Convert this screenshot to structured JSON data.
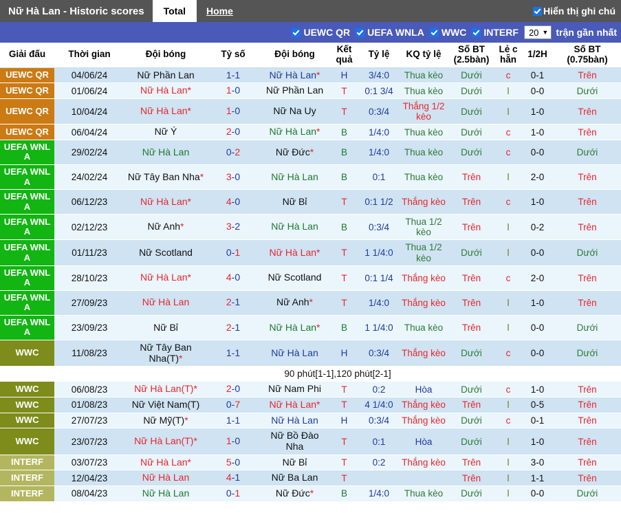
{
  "topbar": {
    "title": "Nữ Hà Lan - Historic scores",
    "tab_total": "Total",
    "link_home": "Home",
    "note_toggle_label": "Hiển thị ghi chú",
    "note_toggle_checked": true,
    "bg_color": "#555555"
  },
  "filterbar": {
    "bg_color": "#4a5ab9",
    "filters": [
      {
        "label": "UEWC QR",
        "checked": true
      },
      {
        "label": "UEFA WNLA",
        "checked": true
      },
      {
        "label": "WWC",
        "checked": true
      },
      {
        "label": "INTERF",
        "checked": true
      }
    ],
    "count_select": {
      "value": "20",
      "caret": "❯"
    },
    "tail_label": "trận gần nhất"
  },
  "table": {
    "headers": [
      "Giải đấu",
      "Thời gian",
      "Đội bóng",
      "Tỷ số",
      "Đội bóng",
      "Kết quả",
      "Tỷ lệ",
      "KQ tỷ lệ",
      "Số BT (2.5bàn)",
      "Lẻ c hẵn",
      "1/2H",
      "Số BT (0.75bàn)"
    ],
    "league_colors": {
      "UEWC QR": "#cc7a14",
      "UEFA WNLA": "#12b512",
      "WWC": "#7d8c1b",
      "INTERF": "#b3b65e"
    },
    "rows": [
      {
        "league": "UEWC QR",
        "league_key": "UEWC QR",
        "date": "04/06/24",
        "home": "Nữ Phần Lan",
        "home_color": "c-black",
        "home_star": false,
        "score_h": "1",
        "score_a": "1",
        "score_h_color": "sc-l",
        "score_a_color": "sc-l",
        "away": "Nữ Hà Lan",
        "away_color": "c-blue",
        "away_star": true,
        "result": "H",
        "result_color": "c-blue",
        "odds": "3/4:0",
        "odds_color": "c-blue",
        "odds_result": "Thua kèo",
        "odds_result_color": "c-dgreen",
        "ou25": "Dưới",
        "ou25_color": "c-dgreen",
        "oddeven": "c",
        "oddeven_color": "c-red",
        "half": "0-1",
        "half_color": "c-black",
        "ou075": "Trên",
        "ou075_color": "c-red"
      },
      {
        "league": "UEWC QR",
        "league_key": "UEWC QR",
        "date": "01/06/24",
        "home": "Nữ Hà Lan",
        "home_color": "c-red",
        "home_star": true,
        "score_h": "1",
        "score_a": "0",
        "score_h_color": "sc-w",
        "score_a_color": "sc-l",
        "away": "Nữ Phần Lan",
        "away_color": "c-black",
        "away_star": false,
        "result": "T",
        "result_color": "c-red",
        "odds": "0:1 3/4",
        "odds_color": "c-blue",
        "odds_result": "Thua kèo",
        "odds_result_color": "c-dgreen",
        "ou25": "Dưới",
        "ou25_color": "c-dgreen",
        "oddeven": "l",
        "oddeven_color": "c-olive",
        "half": "0-0",
        "half_color": "c-black",
        "ou075": "Dưới",
        "ou075_color": "c-dgreen"
      },
      {
        "league": "UEWC QR",
        "league_key": "UEWC QR",
        "date": "10/04/24",
        "home": "Nữ Hà Lan",
        "home_color": "c-red",
        "home_star": true,
        "score_h": "1",
        "score_a": "0",
        "score_h_color": "sc-w",
        "score_a_color": "sc-l",
        "away": "Nữ Na Uy",
        "away_color": "c-black",
        "away_star": false,
        "result": "T",
        "result_color": "c-red",
        "odds": "0:3/4",
        "odds_color": "c-blue",
        "odds_result": "Thắng 1/2 kèo",
        "odds_result_color": "c-red",
        "ou25": "Dưới",
        "ou25_color": "c-dgreen",
        "oddeven": "l",
        "oddeven_color": "c-olive",
        "half": "1-0",
        "half_color": "c-black",
        "ou075": "Trên",
        "ou075_color": "c-red"
      },
      {
        "league": "UEWC QR",
        "league_key": "UEWC QR",
        "date": "06/04/24",
        "home": "Nữ Ý",
        "home_color": "c-black",
        "home_star": false,
        "score_h": "2",
        "score_a": "0",
        "score_h_color": "sc-w",
        "score_a_color": "sc-l",
        "away": "Nữ Hà Lan",
        "away_color": "c-green",
        "away_star": true,
        "result": "B",
        "result_color": "c-green",
        "odds": "1/4:0",
        "odds_color": "c-blue",
        "odds_result": "Thua kèo",
        "odds_result_color": "c-dgreen",
        "ou25": "Dưới",
        "ou25_color": "c-dgreen",
        "oddeven": "c",
        "oddeven_color": "c-red",
        "half": "1-0",
        "half_color": "c-black",
        "ou075": "Trên",
        "ou075_color": "c-red"
      },
      {
        "league": "UEFA WNL A",
        "league_key": "UEFA WNLA",
        "date": "29/02/24",
        "home": "Nữ Hà Lan",
        "home_color": "c-green",
        "home_star": false,
        "score_h": "0",
        "score_a": "2",
        "score_h_color": "sc-l",
        "score_a_color": "sc-w",
        "away": "Nữ Đức",
        "away_color": "c-black",
        "away_star": true,
        "result": "B",
        "result_color": "c-green",
        "odds": "1/4:0",
        "odds_color": "c-blue",
        "odds_result": "Thua kèo",
        "odds_result_color": "c-dgreen",
        "ou25": "Dưới",
        "ou25_color": "c-dgreen",
        "oddeven": "c",
        "oddeven_color": "c-red",
        "half": "0-0",
        "half_color": "c-black",
        "ou075": "Dưới",
        "ou075_color": "c-dgreen"
      },
      {
        "league": "UEFA WNL A",
        "league_key": "UEFA WNLA",
        "date": "24/02/24",
        "home": "Nữ Tây Ban Nha",
        "home_color": "c-black",
        "home_star": true,
        "score_h": "3",
        "score_a": "0",
        "score_h_color": "sc-w",
        "score_a_color": "sc-l",
        "away": "Nữ Hà Lan",
        "away_color": "c-green",
        "away_star": false,
        "result": "B",
        "result_color": "c-green",
        "odds": "0:1",
        "odds_color": "c-blue",
        "odds_result": "Thua kèo",
        "odds_result_color": "c-dgreen",
        "ou25": "Trên",
        "ou25_color": "c-red",
        "oddeven": "l",
        "oddeven_color": "c-olive",
        "half": "2-0",
        "half_color": "c-black",
        "ou075": "Trên",
        "ou075_color": "c-red"
      },
      {
        "league": "UEFA WNL A",
        "league_key": "UEFA WNLA",
        "date": "06/12/23",
        "home": "Nữ Hà Lan",
        "home_color": "c-red",
        "home_star": true,
        "score_h": "4",
        "score_a": "0",
        "score_h_color": "sc-w",
        "score_a_color": "sc-l",
        "away": "Nữ Bỉ",
        "away_color": "c-black",
        "away_star": false,
        "result": "T",
        "result_color": "c-red",
        "odds": "0:1 1/2",
        "odds_color": "c-blue",
        "odds_result": "Thắng kèo",
        "odds_result_color": "c-red",
        "ou25": "Trên",
        "ou25_color": "c-red",
        "oddeven": "c",
        "oddeven_color": "c-red",
        "half": "1-0",
        "half_color": "c-black",
        "ou075": "Trên",
        "ou075_color": "c-red"
      },
      {
        "league": "UEFA WNL A",
        "league_key": "UEFA WNLA",
        "date": "02/12/23",
        "home": "Nữ Anh",
        "home_color": "c-black",
        "home_star": true,
        "score_h": "3",
        "score_a": "2",
        "score_h_color": "sc-w",
        "score_a_color": "sc-l",
        "away": "Nữ Hà Lan",
        "away_color": "c-green",
        "away_star": false,
        "result": "B",
        "result_color": "c-green",
        "odds": "0:3/4",
        "odds_color": "c-blue",
        "odds_result": "Thua 1/2 kèo",
        "odds_result_color": "c-dgreen",
        "ou25": "Trên",
        "ou25_color": "c-red",
        "oddeven": "l",
        "oddeven_color": "c-olive",
        "half": "0-2",
        "half_color": "c-black",
        "ou075": "Trên",
        "ou075_color": "c-red"
      },
      {
        "league": "UEFA WNL A",
        "league_key": "UEFA WNLA",
        "date": "01/11/23",
        "home": "Nữ Scotland",
        "home_color": "c-black",
        "home_star": false,
        "score_h": "0",
        "score_a": "1",
        "score_h_color": "sc-l",
        "score_a_color": "sc-w",
        "away": "Nữ Hà Lan",
        "away_color": "c-red",
        "away_star": true,
        "result": "T",
        "result_color": "c-red",
        "odds": "1 1/4:0",
        "odds_color": "c-blue",
        "odds_result": "Thua 1/2 kèo",
        "odds_result_color": "c-dgreen",
        "ou25": "Dưới",
        "ou25_color": "c-dgreen",
        "oddeven": "l",
        "oddeven_color": "c-olive",
        "half": "0-0",
        "half_color": "c-black",
        "ou075": "Dưới",
        "ou075_color": "c-dgreen"
      },
      {
        "league": "UEFA WNL A",
        "league_key": "UEFA WNLA",
        "date": "28/10/23",
        "home": "Nữ Hà Lan",
        "home_color": "c-red",
        "home_star": true,
        "score_h": "4",
        "score_a": "0",
        "score_h_color": "sc-w",
        "score_a_color": "sc-l",
        "away": "Nữ Scotland",
        "away_color": "c-black",
        "away_star": false,
        "result": "T",
        "result_color": "c-red",
        "odds": "0:1 1/4",
        "odds_color": "c-blue",
        "odds_result": "Thắng kèo",
        "odds_result_color": "c-red",
        "ou25": "Trên",
        "ou25_color": "c-red",
        "oddeven": "c",
        "oddeven_color": "c-red",
        "half": "2-0",
        "half_color": "c-black",
        "ou075": "Trên",
        "ou075_color": "c-red"
      },
      {
        "league": "UEFA WNL A",
        "league_key": "UEFA WNLA",
        "date": "27/09/23",
        "home": "Nữ Hà Lan",
        "home_color": "c-red",
        "home_star": false,
        "score_h": "2",
        "score_a": "1",
        "score_h_color": "sc-w",
        "score_a_color": "sc-l",
        "away": "Nữ Anh",
        "away_color": "c-black",
        "away_star": true,
        "result": "T",
        "result_color": "c-red",
        "odds": "1/4:0",
        "odds_color": "c-blue",
        "odds_result": "Thắng kèo",
        "odds_result_color": "c-red",
        "ou25": "Trên",
        "ou25_color": "c-red",
        "oddeven": "l",
        "oddeven_color": "c-olive",
        "half": "1-0",
        "half_color": "c-black",
        "ou075": "Trên",
        "ou075_color": "c-red"
      },
      {
        "league": "UEFA WNL A",
        "league_key": "UEFA WNLA",
        "date": "23/09/23",
        "home": "Nữ Bỉ",
        "home_color": "c-black",
        "home_star": false,
        "score_h": "2",
        "score_a": "1",
        "score_h_color": "sc-w",
        "score_a_color": "sc-l",
        "away": "Nữ Hà Lan",
        "away_color": "c-green",
        "away_star": true,
        "result": "B",
        "result_color": "c-green",
        "odds": "1 1/4:0",
        "odds_color": "c-blue",
        "odds_result": "Thua kèo",
        "odds_result_color": "c-dgreen",
        "ou25": "Trên",
        "ou25_color": "c-red",
        "oddeven": "l",
        "oddeven_color": "c-olive",
        "half": "0-0",
        "half_color": "c-black",
        "ou075": "Dưới",
        "ou075_color": "c-dgreen"
      },
      {
        "league": "WWC",
        "league_key": "WWC",
        "date": "11/08/23",
        "home": "Nữ Tây Ban Nha(T)",
        "home_color": "c-black",
        "home_star": true,
        "score_h": "1",
        "score_a": "1",
        "score_h_color": "sc-l",
        "score_a_color": "sc-l",
        "away": "Nữ Hà Lan",
        "away_color": "c-blue",
        "away_star": false,
        "result": "H",
        "result_color": "c-blue",
        "odds": "0:3/4",
        "odds_color": "c-blue",
        "odds_result": "Thắng kèo",
        "odds_result_color": "c-red",
        "ou25": "Dưới",
        "ou25_color": "c-dgreen",
        "oddeven": "c",
        "oddeven_color": "c-red",
        "half": "0-0",
        "half_color": "c-black",
        "ou075": "Dưới",
        "ou075_color": "c-dgreen",
        "note": "90 phút[1-1],120 phút[2-1]"
      },
      {
        "league": "WWC",
        "league_key": "WWC",
        "date": "06/08/23",
        "home": "Nữ Hà Lan(T)",
        "home_color": "c-red",
        "home_star": true,
        "score_h": "2",
        "score_a": "0",
        "score_h_color": "sc-w",
        "score_a_color": "sc-l",
        "away": "Nữ Nam Phi",
        "away_color": "c-black",
        "away_star": false,
        "result": "T",
        "result_color": "c-red",
        "odds": "0:2",
        "odds_color": "c-blue",
        "odds_result": "Hòa",
        "odds_result_color": "c-blue",
        "ou25": "Dưới",
        "ou25_color": "c-dgreen",
        "oddeven": "c",
        "oddeven_color": "c-red",
        "half": "1-0",
        "half_color": "c-black",
        "ou075": "Trên",
        "ou075_color": "c-red"
      },
      {
        "league": "WWC",
        "league_key": "WWC",
        "date": "01/08/23",
        "home": "Nữ Việt Nam(T)",
        "home_color": "c-black",
        "home_star": false,
        "score_h": "0",
        "score_a": "7",
        "score_h_color": "sc-l",
        "score_a_color": "sc-w",
        "away": "Nữ Hà Lan",
        "away_color": "c-red",
        "away_star": true,
        "result": "T",
        "result_color": "c-red",
        "odds": "4 1/4:0",
        "odds_color": "c-blue",
        "odds_result": "Thắng kèo",
        "odds_result_color": "c-red",
        "ou25": "Trên",
        "ou25_color": "c-red",
        "oddeven": "l",
        "oddeven_color": "c-olive",
        "half": "0-5",
        "half_color": "c-black",
        "ou075": "Trên",
        "ou075_color": "c-red"
      },
      {
        "league": "WWC",
        "league_key": "WWC",
        "date": "27/07/23",
        "home": "Nữ Mỹ(T)",
        "home_color": "c-black",
        "home_star": true,
        "score_h": "1",
        "score_a": "1",
        "score_h_color": "sc-l",
        "score_a_color": "sc-l",
        "away": "Nữ Hà Lan",
        "away_color": "c-blue",
        "away_star": false,
        "result": "H",
        "result_color": "c-blue",
        "odds": "0:3/4",
        "odds_color": "c-blue",
        "odds_result": "Thắng kèo",
        "odds_result_color": "c-red",
        "ou25": "Dưới",
        "ou25_color": "c-dgreen",
        "oddeven": "c",
        "oddeven_color": "c-red",
        "half": "0-1",
        "half_color": "c-black",
        "ou075": "Trên",
        "ou075_color": "c-red"
      },
      {
        "league": "WWC",
        "league_key": "WWC",
        "date": "23/07/23",
        "home": "Nữ Hà Lan(T)",
        "home_color": "c-red",
        "home_star": true,
        "score_h": "1",
        "score_a": "0",
        "score_h_color": "sc-w",
        "score_a_color": "sc-l",
        "away": "Nữ Bồ Đào Nha",
        "away_color": "c-black",
        "away_star": false,
        "result": "T",
        "result_color": "c-red",
        "odds": "0:1",
        "odds_color": "c-blue",
        "odds_result": "Hòa",
        "odds_result_color": "c-blue",
        "ou25": "Dưới",
        "ou25_color": "c-dgreen",
        "oddeven": "l",
        "oddeven_color": "c-olive",
        "half": "1-0",
        "half_color": "c-black",
        "ou075": "Trên",
        "ou075_color": "c-red"
      },
      {
        "league": "INTERF",
        "league_key": "INTERF",
        "date": "03/07/23",
        "home": "Nữ Hà Lan",
        "home_color": "c-red",
        "home_star": true,
        "score_h": "5",
        "score_a": "0",
        "score_h_color": "sc-w",
        "score_a_color": "sc-l",
        "away": "Nữ Bỉ",
        "away_color": "c-black",
        "away_star": false,
        "result": "T",
        "result_color": "c-red",
        "odds": "0:2",
        "odds_color": "c-blue",
        "odds_result": "Thắng kèo",
        "odds_result_color": "c-red",
        "ou25": "Trên",
        "ou25_color": "c-red",
        "oddeven": "l",
        "oddeven_color": "c-olive",
        "half": "3-0",
        "half_color": "c-black",
        "ou075": "Trên",
        "ou075_color": "c-red"
      },
      {
        "league": "INTERF",
        "league_key": "INTERF",
        "date": "12/04/23",
        "home": "Nữ Hà Lan",
        "home_color": "c-red",
        "home_star": false,
        "score_h": "4",
        "score_a": "1",
        "score_h_color": "sc-w",
        "score_a_color": "sc-l",
        "away": "Nữ Ba Lan",
        "away_color": "c-black",
        "away_star": false,
        "result": "T",
        "result_color": "c-red",
        "odds": "",
        "odds_color": "c-blue",
        "odds_result": "",
        "odds_result_color": "c-red",
        "ou25": "Trên",
        "ou25_color": "c-red",
        "oddeven": "l",
        "oddeven_color": "c-olive",
        "half": "1-1",
        "half_color": "c-black",
        "ou075": "Trên",
        "ou075_color": "c-red"
      },
      {
        "league": "INTERF",
        "league_key": "INTERF",
        "date": "08/04/23",
        "home": "Nữ Hà Lan",
        "home_color": "c-green",
        "home_star": false,
        "score_h": "0",
        "score_a": "1",
        "score_h_color": "sc-l",
        "score_a_color": "sc-w",
        "away": "Nữ Đức",
        "away_color": "c-black",
        "away_star": true,
        "result": "B",
        "result_color": "c-green",
        "odds": "1/4:0",
        "odds_color": "c-blue",
        "odds_result": "Thua kèo",
        "odds_result_color": "c-dgreen",
        "ou25": "Dưới",
        "ou25_color": "c-dgreen",
        "oddeven": "l",
        "oddeven_color": "c-olive",
        "half": "0-0",
        "half_color": "c-black",
        "ou075": "Dưới",
        "ou075_color": "c-dgreen"
      }
    ]
  }
}
